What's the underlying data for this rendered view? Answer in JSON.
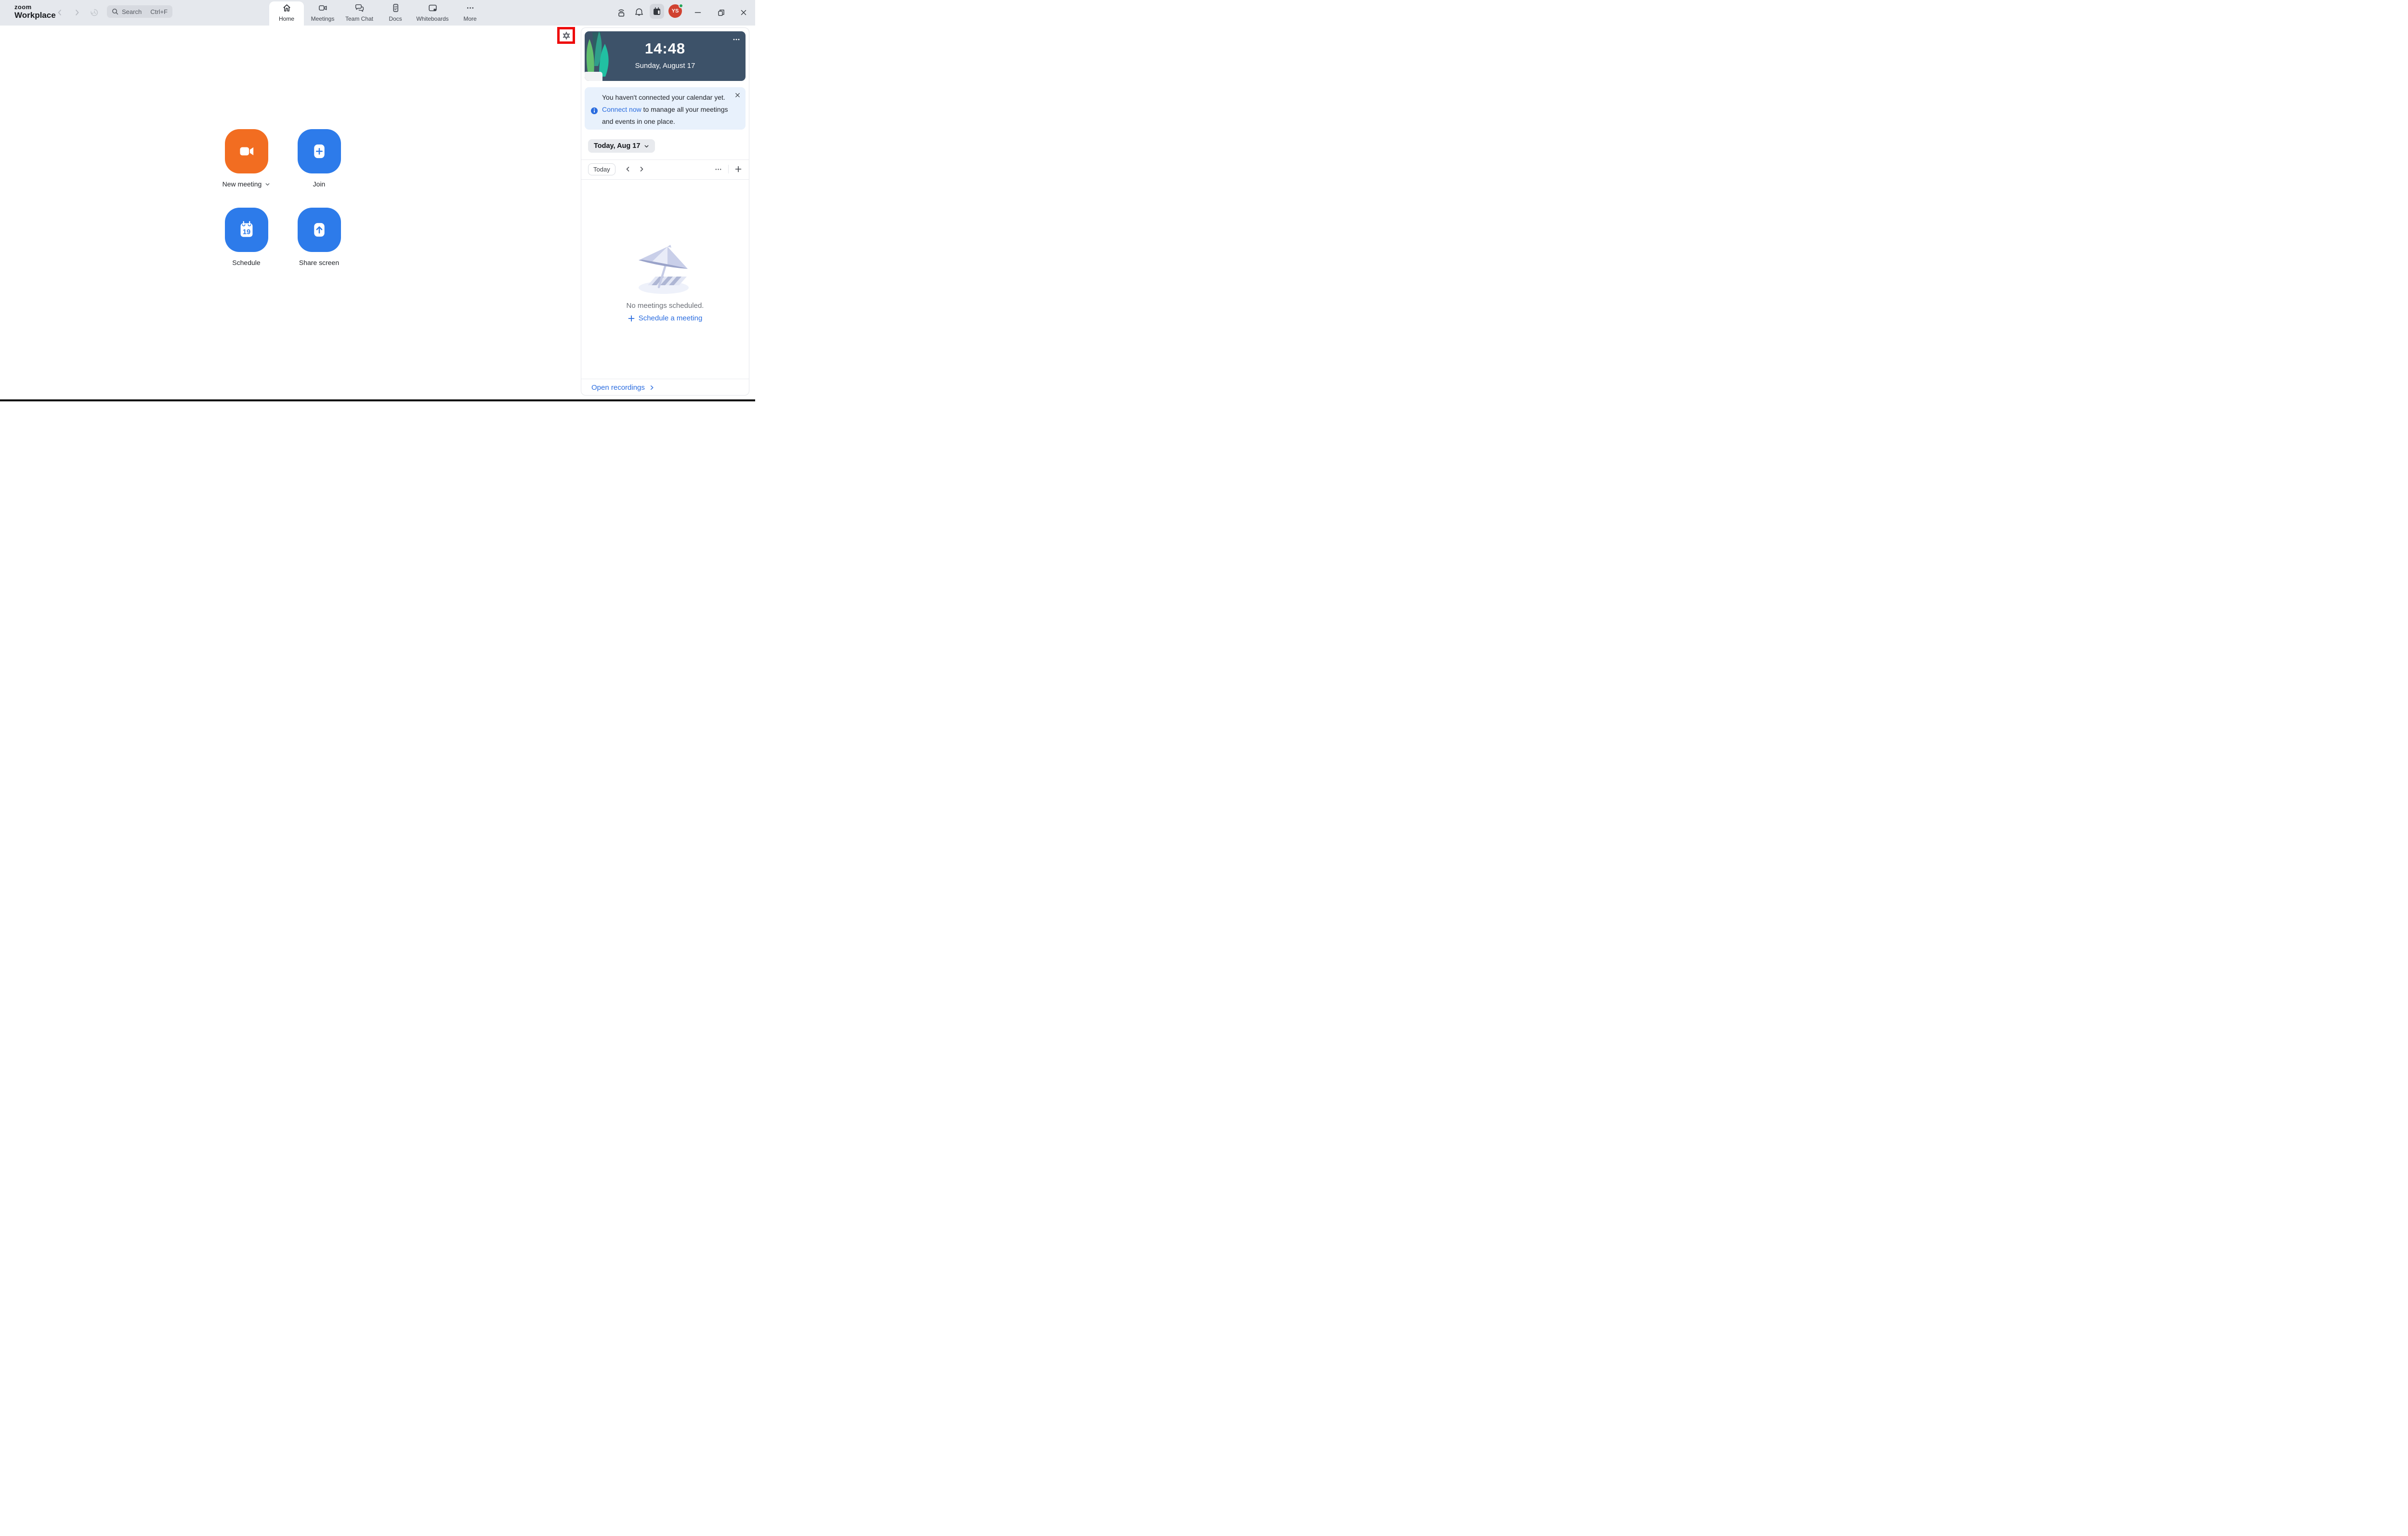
{
  "titlebar": {
    "logo": {
      "line1": "zoom",
      "line2": "Workplace"
    },
    "search": {
      "placeholder": "Search",
      "shortcut": "Ctrl+F",
      "icon": "search-icon"
    },
    "tabs": [
      {
        "label": "Home",
        "icon": "home-icon",
        "active": true
      },
      {
        "label": "Meetings",
        "icon": "video-camera-icon",
        "active": false
      },
      {
        "label": "Team Chat",
        "icon": "chat-bubbles-icon",
        "active": false
      },
      {
        "label": "Docs",
        "icon": "document-icon",
        "active": false
      },
      {
        "label": "Whiteboards",
        "icon": "whiteboard-icon",
        "active": false
      },
      {
        "label": "More",
        "icon": "ellipsis-icon",
        "active": false
      }
    ],
    "status_icons": [
      {
        "name": "companion-device-icon"
      },
      {
        "name": "bell-icon"
      },
      {
        "name": "calendar-icon",
        "active": true
      }
    ],
    "avatar": {
      "initials": "YS",
      "presence_color": "#23a55a"
    },
    "window_controls": [
      "minimize-icon",
      "restore-icon",
      "close-icon"
    ]
  },
  "main": {
    "settings": {
      "icon": "gear-icon",
      "annotation_color": "#ee0a0a"
    },
    "quick_actions": [
      {
        "label": "New meeting",
        "color": "#f26d21",
        "icon": "video-camera-icon",
        "has_dropdown": true
      },
      {
        "label": "Join",
        "color": "#2d7bea",
        "icon": "plus-icon"
      },
      {
        "label": "Schedule",
        "color": "#2d7bea",
        "icon": "calendar-icon",
        "badge_day": "19"
      },
      {
        "label": "Share screen",
        "color": "#2d7bea",
        "icon": "arrow-up-icon"
      }
    ]
  },
  "panel": {
    "time_card": {
      "time": "14:48",
      "date": "Sunday, August 17",
      "menu_icon": "ellipsis-icon"
    },
    "calendar_notice": {
      "icon": "info-icon",
      "text_before_link": "You haven't connected your calendar yet.",
      "link_text": "Connect now",
      "text_after_link": " to manage all your meetings and events in one place.",
      "close_icon": "close-icon"
    },
    "date_selector": {
      "label": "Today, Aug 17",
      "chevron": "chevron-down-icon"
    },
    "toolbar": {
      "today_button": "Today",
      "prev": "chevron-left-icon",
      "next": "chevron-right-icon",
      "more": "ellipsis-icon",
      "add": "plus-icon"
    },
    "empty_state": {
      "illustration": "beach-umbrella-illustration",
      "message": "No meetings scheduled.",
      "cta_label": "Schedule a meeting"
    },
    "footer": {
      "link_label": "Open recordings",
      "chevron": "chevron-right-icon"
    }
  },
  "colors": {
    "header_bg": "#e5e8ed",
    "accent_orange": "#f26d21",
    "accent_blue": "#2d7bea",
    "link_blue": "#2a6cdf",
    "time_card_bg": "#3d5269",
    "notice_bg": "#e8f1fc",
    "avatar_red": "#d04231",
    "presence_green": "#23a55a",
    "annotation_red": "#ee0a0a"
  }
}
